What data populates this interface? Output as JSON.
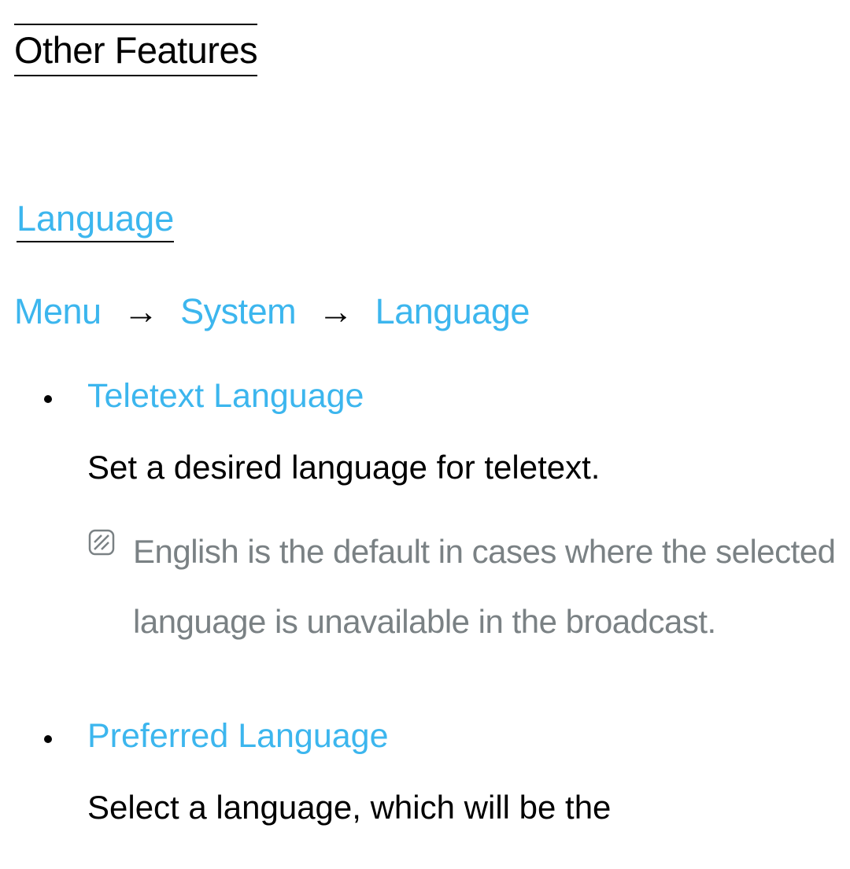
{
  "pageTitle": "Other Features",
  "sectionTitle": "Language",
  "breadcrumb": {
    "items": [
      "Menu",
      "System",
      "Language"
    ],
    "separator": "→"
  },
  "items": [
    {
      "title": "Teletext Language",
      "description": "Set a desired language for teletext.",
      "note": "English is the default in cases where the selected language is unavailable in the broadcast."
    },
    {
      "title": "Preferred Language",
      "description": "Select a language, which will be the"
    }
  ]
}
